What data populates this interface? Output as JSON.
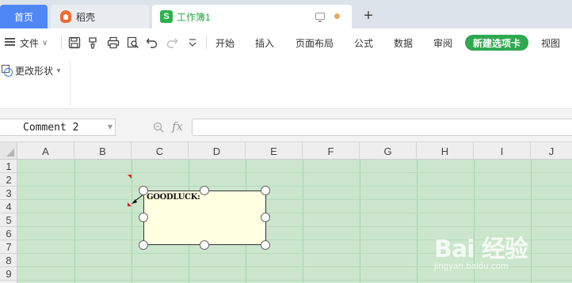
{
  "tabs": {
    "home": "首页",
    "daoke": "稻壳",
    "workbook": "工作簿1",
    "workbook_icon": "S"
  },
  "menu": {
    "file": "文件",
    "items": [
      "开始",
      "插入",
      "页面布局",
      "公式",
      "数据",
      "审阅"
    ],
    "new_tab": "新建选项卡",
    "view": "视图"
  },
  "ribbon": {
    "change_shape": "更改形状"
  },
  "formula_bar": {
    "name_box": "Comment 2",
    "fx": "fx",
    "formula": ""
  },
  "sheet": {
    "columns": [
      "A",
      "B",
      "C",
      "D",
      "E",
      "F",
      "G",
      "H",
      "I",
      "J"
    ],
    "rows": [
      "1",
      "2",
      "3",
      "4",
      "5",
      "6",
      "7",
      "8",
      "9"
    ],
    "comment_text": "GOODLUCK:"
  },
  "watermark": {
    "brand": "Bai  经验",
    "url": "jingyan.baidu.com"
  },
  "colors": {
    "accent_blue": "#4f88f5",
    "accent_green": "#2fa84f",
    "grid_bg": "#cbe6cd",
    "comment_bg": "#ffffe1"
  }
}
